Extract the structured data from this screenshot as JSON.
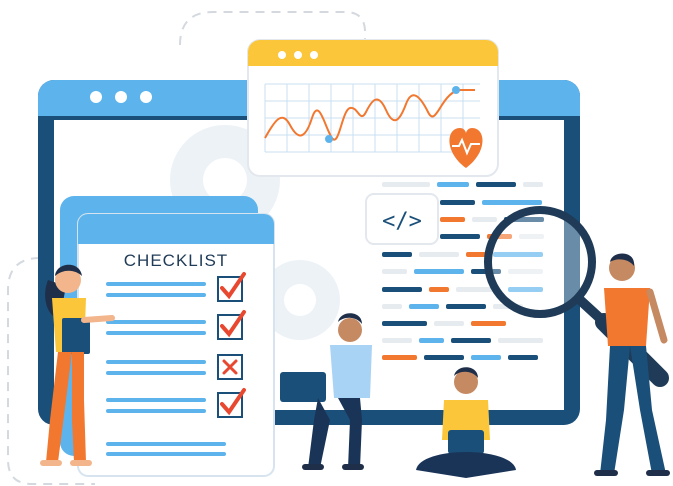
{
  "checklist": {
    "title": "CHECKLIST",
    "items": [
      {
        "state": "checked"
      },
      {
        "state": "checked"
      },
      {
        "state": "crossed"
      },
      {
        "state": "checked"
      }
    ]
  },
  "code_icon": {
    "label": "</>"
  },
  "colors": {
    "window_blue": "#1a4f7a",
    "frame_light_blue": "#5db4ec",
    "accent_yellow": "#fcc63a",
    "accent_orange": "#f2772f",
    "check_red": "#e8482f",
    "heart_orange": "#f2772f",
    "gear_gray": "#e8eef5"
  },
  "icons": [
    "window-dots-icon",
    "heart-pulse-icon",
    "code-icon",
    "magnifier-icon",
    "checkmark-icon",
    "cross-icon"
  ]
}
